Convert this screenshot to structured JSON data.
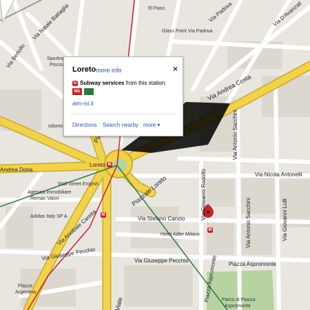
{
  "streets": {
    "via_el_paso": "El Paso",
    "via_natale_battaglia": "Via Natale Battaglia",
    "via_padova": "Via Padova",
    "via_davanzati": "Via D'Avanzati",
    "via_bertollo": "Via Bertollo",
    "sporting_club": "Sporting Club",
    "piscina": "Piscina Milano",
    "glass_point": "Glass Point Via Padova",
    "via_andrea_costa": "Via Andrea Costa",
    "via_antonio_sacchini_1": "Via Antonio Sacchini",
    "via_nicola_antonelli": "Via Nicola Antonelli",
    "piazzale_loreto_1": "Piazzale Loreto",
    "piazzale_loreto_2": "Piazzale Loreto",
    "andrea_doria": "Andrea Doria",
    "loreto_station": "Loreto",
    "wall_street_english": "Wall Street English",
    "agenzia": "Agenzia Immobiliare",
    "remax": "Remax Valori",
    "adidas": "Adidas Italy SP A",
    "via_annibale_caretta": "Via Annibale Caretta",
    "via_stefano_canzio": "Via Stefano Canzio",
    "via_giovanni_rodolfo": "Via Giovanni Rodolfo",
    "via_antonio_sacchini_2": "Via Antonio Sacchini",
    "via_giovanni_lulli": "Via Giovanni Lulli",
    "hotel_adler": "Hotel Adler Milano",
    "via_giuseppe_pecchio_1": "Via Giuseppe Pecchio",
    "via_giuseppe_pecchio_2": "Via Giuseppe Pecchio",
    "piazza_aspromonte_1": "Piazza Aspromonte",
    "piazza_aspromonte_2": "Piazza Aspromonte",
    "parco_line1": "Parco di Piazza",
    "parco_line2": "Aspromonte",
    "piazza_argentina_1": "Piazza",
    "piazza_argentina_2": "Argentina",
    "viale": "Viale",
    "odonto": "odonto",
    "metro_m": "M"
  },
  "info_window": {
    "title": "Loreto",
    "more_info": "more info",
    "close": "×",
    "subway_label": "Subway services",
    "subway_suffix": "from this station:",
    "subway_logo": "M",
    "line_m1": "M1",
    "link": "atm-mi.it",
    "directions": "Directions",
    "search_nearby": "Search nearby",
    "more": "more",
    "more_caret": "▾"
  },
  "colors": {
    "major_road": "#f2d24a",
    "metro_red": "#c5252c",
    "metro_green": "#2d7a3a",
    "park": "#b6d3a1",
    "link": "#2a58a8"
  }
}
